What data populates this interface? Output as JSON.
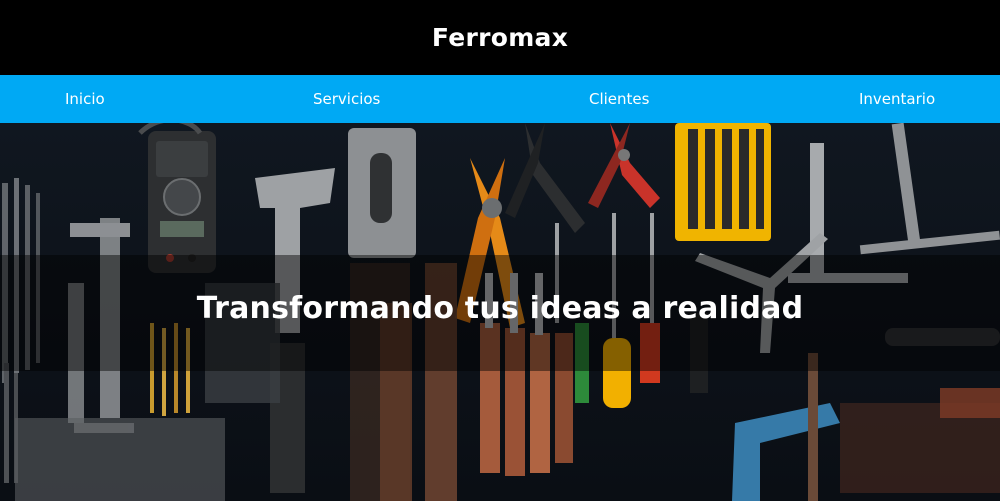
{
  "brand": {
    "name": "Ferromax"
  },
  "nav": {
    "items": [
      {
        "label": "Inicio"
      },
      {
        "label": "Servicios"
      },
      {
        "label": "Clientes"
      },
      {
        "label": "Inventario"
      }
    ]
  },
  "hero": {
    "title": "Transformando tus ideas a realidad",
    "image_description_icon": "tools-background-image"
  },
  "colors": {
    "header_bg": "#000000",
    "nav_bg": "#00a9f4",
    "text": "#ffffff"
  }
}
